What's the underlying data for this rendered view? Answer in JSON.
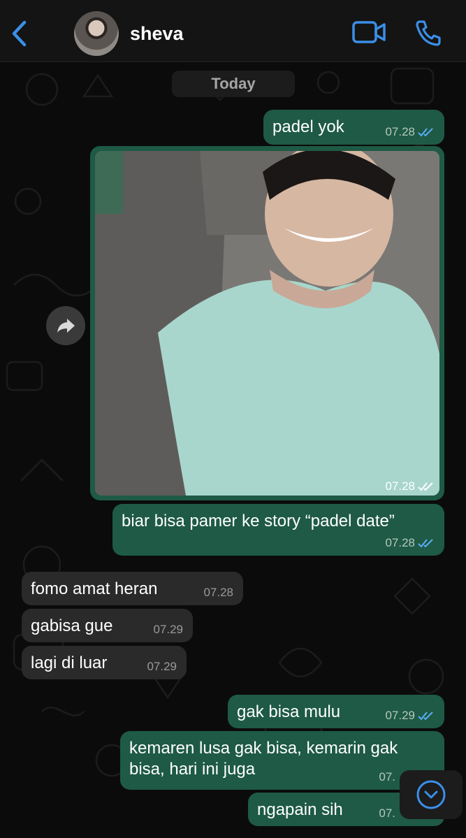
{
  "contact": {
    "name": "sheva"
  },
  "date_separator": "Today",
  "messages": [
    {
      "text": "padel yok",
      "time": "07.28"
    },
    {
      "type": "photo",
      "time": "07.28"
    },
    {
      "text": "biar bisa pamer ke story “padel date”",
      "time": "07.28"
    },
    {
      "text": "fomo amat heran",
      "time": "07.28"
    },
    {
      "text": "gabisa gue",
      "time": "07.29"
    },
    {
      "text": "lagi di luar",
      "time": "07.29"
    },
    {
      "text": "gak bisa mulu",
      "time": "07.29"
    },
    {
      "line1": "kemaren lusa gak bisa, kemarin gak",
      "line2": "bisa, hari ini juga",
      "time": "07."
    },
    {
      "text": "ngapain sih",
      "time": "07."
    }
  ],
  "colors": {
    "outgoing_bubble": "#1e5a45",
    "incoming_bubble": "#2a2a2a",
    "accent": "#3b8fe8"
  },
  "icons": [
    "chevron-left-icon",
    "video-camera-icon",
    "phone-icon",
    "forward-icon",
    "chevron-down-icon",
    "double-check-icon"
  ]
}
